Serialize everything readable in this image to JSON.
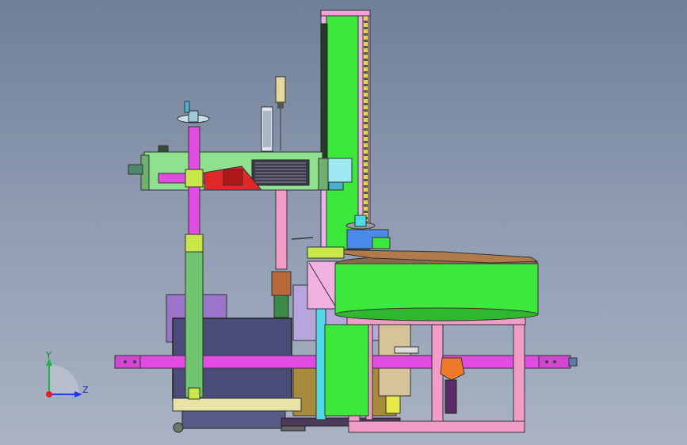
{
  "viewport": {
    "background_top": "#6f7f97",
    "background_bottom": "#a9b3c4"
  },
  "triad": {
    "x_label": "",
    "y_label": "Y",
    "z_label": "Z",
    "y_color": "#22b14c",
    "z_color": "#1e3cff",
    "origin_color": "#e02020"
  },
  "palette": {
    "magenta": "#e04be0",
    "green": "#3de83d",
    "light_green": "#8fe08f",
    "pink": "#f29cc8",
    "cyan": "#4fd8e8",
    "purple": "#9a74c8",
    "navy": "#4b4c78",
    "orange": "#f07a2a",
    "red": "#e02828",
    "yellow_green": "#c8e84a",
    "olive": "#b59a4a"
  }
}
